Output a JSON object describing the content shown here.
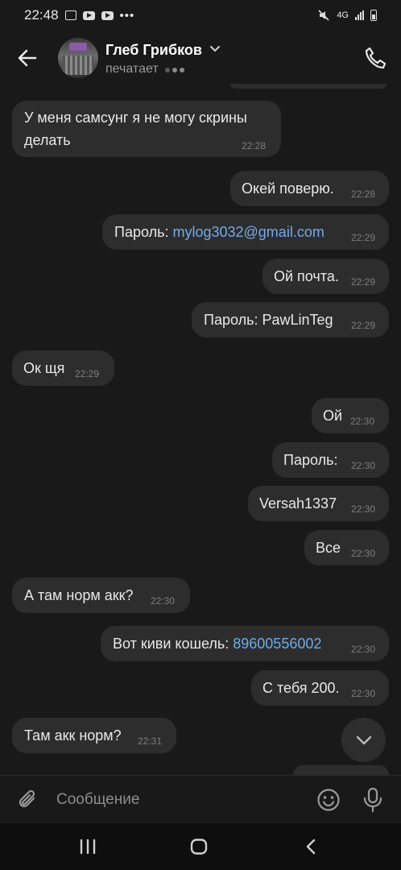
{
  "status_bar": {
    "time": "22:48",
    "network": "4G"
  },
  "header": {
    "name": "Глеб Грибков",
    "status": "печатает"
  },
  "messages": [
    {
      "text": "У меня самсунг я не могу скрины",
      "text2": "делать",
      "time": "22:28",
      "side": "in"
    },
    {
      "text": "Окей поверю.",
      "time": "22:28",
      "side": "out"
    },
    {
      "prefix": "Пароль: ",
      "link": "mylog3032@gmail.com",
      "time": "22:29",
      "side": "out"
    },
    {
      "text": "Ой почта.",
      "time": "22:29",
      "side": "out"
    },
    {
      "text": "Пароль: PawLinTeg",
      "time": "22:29",
      "side": "out"
    },
    {
      "text": "Ок щя",
      "time": "22:29",
      "side": "in"
    },
    {
      "text": "Ой",
      "time": "22:30",
      "side": "out"
    },
    {
      "text": "Пароль:",
      "time": "22:30",
      "side": "out"
    },
    {
      "text": "Versah1337",
      "time": "22:30",
      "side": "out"
    },
    {
      "text": "Все",
      "time": "22:30",
      "side": "out"
    },
    {
      "text": "А там норм акк?",
      "time": "22:30",
      "side": "in"
    },
    {
      "prefix": "Вот киви кошель: ",
      "link": "89600556002",
      "time": "22:30",
      "side": "out"
    },
    {
      "text": "С тебя 200.",
      "time": "22:30",
      "side": "out"
    },
    {
      "text": "Там акк норм?",
      "time": "22:31",
      "side": "in"
    }
  ],
  "composer": {
    "placeholder": "Сообщение"
  },
  "colors": {
    "background": "#191919",
    "bubble": "#2d2d2d",
    "link": "#71aaeb",
    "time": "#7d7d7d"
  },
  "icons": {
    "back": "arrow-left-icon",
    "call": "phone-icon",
    "attach": "paperclip-icon",
    "emoji": "smile-icon",
    "mic": "microphone-icon",
    "scroll": "chevron-down-icon"
  }
}
